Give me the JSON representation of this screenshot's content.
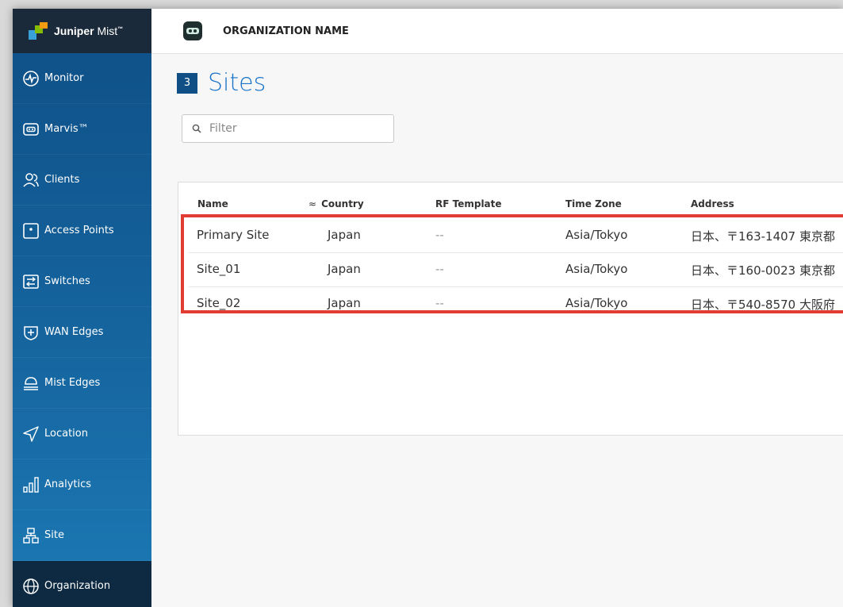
{
  "brand": {
    "name_bold": "Juniper",
    "name_light": " Mist",
    "tm": "™"
  },
  "sidebar": {
    "items": [
      {
        "label": "Monitor",
        "icon": "monitor-icon"
      },
      {
        "label": "Marvis™",
        "icon": "marvis-icon"
      },
      {
        "label": "Clients",
        "icon": "clients-icon"
      },
      {
        "label": "Access Points",
        "icon": "access-points-icon"
      },
      {
        "label": "Switches",
        "icon": "switches-icon"
      },
      {
        "label": "WAN Edges",
        "icon": "wan-edges-icon"
      },
      {
        "label": "Mist Edges",
        "icon": "mist-edges-icon"
      },
      {
        "label": "Location",
        "icon": "location-icon"
      },
      {
        "label": "Analytics",
        "icon": "analytics-icon"
      },
      {
        "label": "Site",
        "icon": "site-icon"
      },
      {
        "label": "Organization",
        "icon": "organization-icon",
        "active": true
      }
    ]
  },
  "header": {
    "org_name": "ORGANIZATION NAME"
  },
  "page": {
    "count": "3",
    "title": "Sites"
  },
  "filter": {
    "placeholder": "Filter"
  },
  "table": {
    "columns": [
      "Name",
      "Country",
      "RF Template",
      "Time Zone",
      "Address"
    ],
    "rows": [
      {
        "name": "Primary Site",
        "country": "Japan",
        "rf_template": "--",
        "time_zone": "Asia/Tokyo",
        "address": "日本、〒163-1407 東京都"
      },
      {
        "name": "Site_01",
        "country": "Japan",
        "rf_template": "--",
        "time_zone": "Asia/Tokyo",
        "address": "日本、〒160-0023 東京都"
      },
      {
        "name": "Site_02",
        "country": "Japan",
        "rf_template": "--",
        "time_zone": "Asia/Tokyo",
        "address": "日本、〒540-8570 大阪府"
      }
    ]
  },
  "colors": {
    "sidebar": "#0f4f86",
    "accent": "#1a73c7",
    "highlight": "#e03c31"
  }
}
